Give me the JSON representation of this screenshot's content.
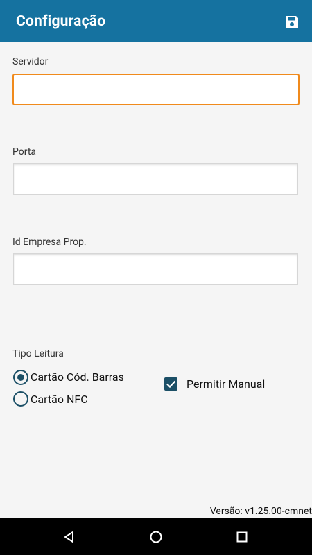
{
  "app": {
    "title": "Configuração",
    "save_icon": "save-icon"
  },
  "form": {
    "servidor": {
      "label": "Servidor",
      "value": ""
    },
    "porta": {
      "label": "Porta",
      "value": ""
    },
    "id_empresa": {
      "label": "Id Empresa Prop.",
      "value": ""
    },
    "tipo_leitura": {
      "label": "Tipo Leitura",
      "options": [
        {
          "label": "Cartão Cód. Barras",
          "selected": true
        },
        {
          "label": "Cartão NFC",
          "selected": false
        }
      ]
    },
    "permitir_manual": {
      "label": "Permitir Manual",
      "checked": true
    }
  },
  "footer": {
    "version": "Versão: v1.25.00-cmnet"
  },
  "colors": {
    "appbar": "#1572a0",
    "focus": "#f08a1c",
    "control": "#1b4f66"
  },
  "navbar": {
    "icons": [
      "back-icon",
      "home-icon",
      "recents-icon"
    ]
  }
}
